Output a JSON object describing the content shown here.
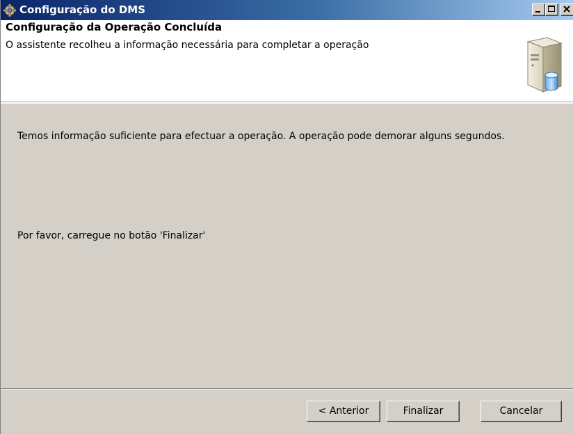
{
  "window": {
    "title": "Configuração do DMS",
    "title_icon": "gear-icon",
    "controls": [
      "minimize-icon",
      "maximize-icon",
      "close-icon"
    ]
  },
  "header": {
    "title": "Configuração da Operação Concluída",
    "subtitle": "O assistente recolheu a informação necessária para completar a operação",
    "icon": "server-database-icon"
  },
  "body": {
    "paragraph1": "Temos informação suficiente para efectuar a operação.  A operação pode demorar alguns segundos.",
    "paragraph2": "Por favor, carregue no botão 'Finalizar'"
  },
  "buttons": {
    "back": "< Anterior",
    "finish": "Finalizar",
    "cancel": "Cancelar"
  },
  "colors": {
    "titlebar_start": "#0a246a",
    "titlebar_end": "#a6caf0",
    "dialog_background": "#d4d0c8",
    "header_background": "#ffffff"
  }
}
